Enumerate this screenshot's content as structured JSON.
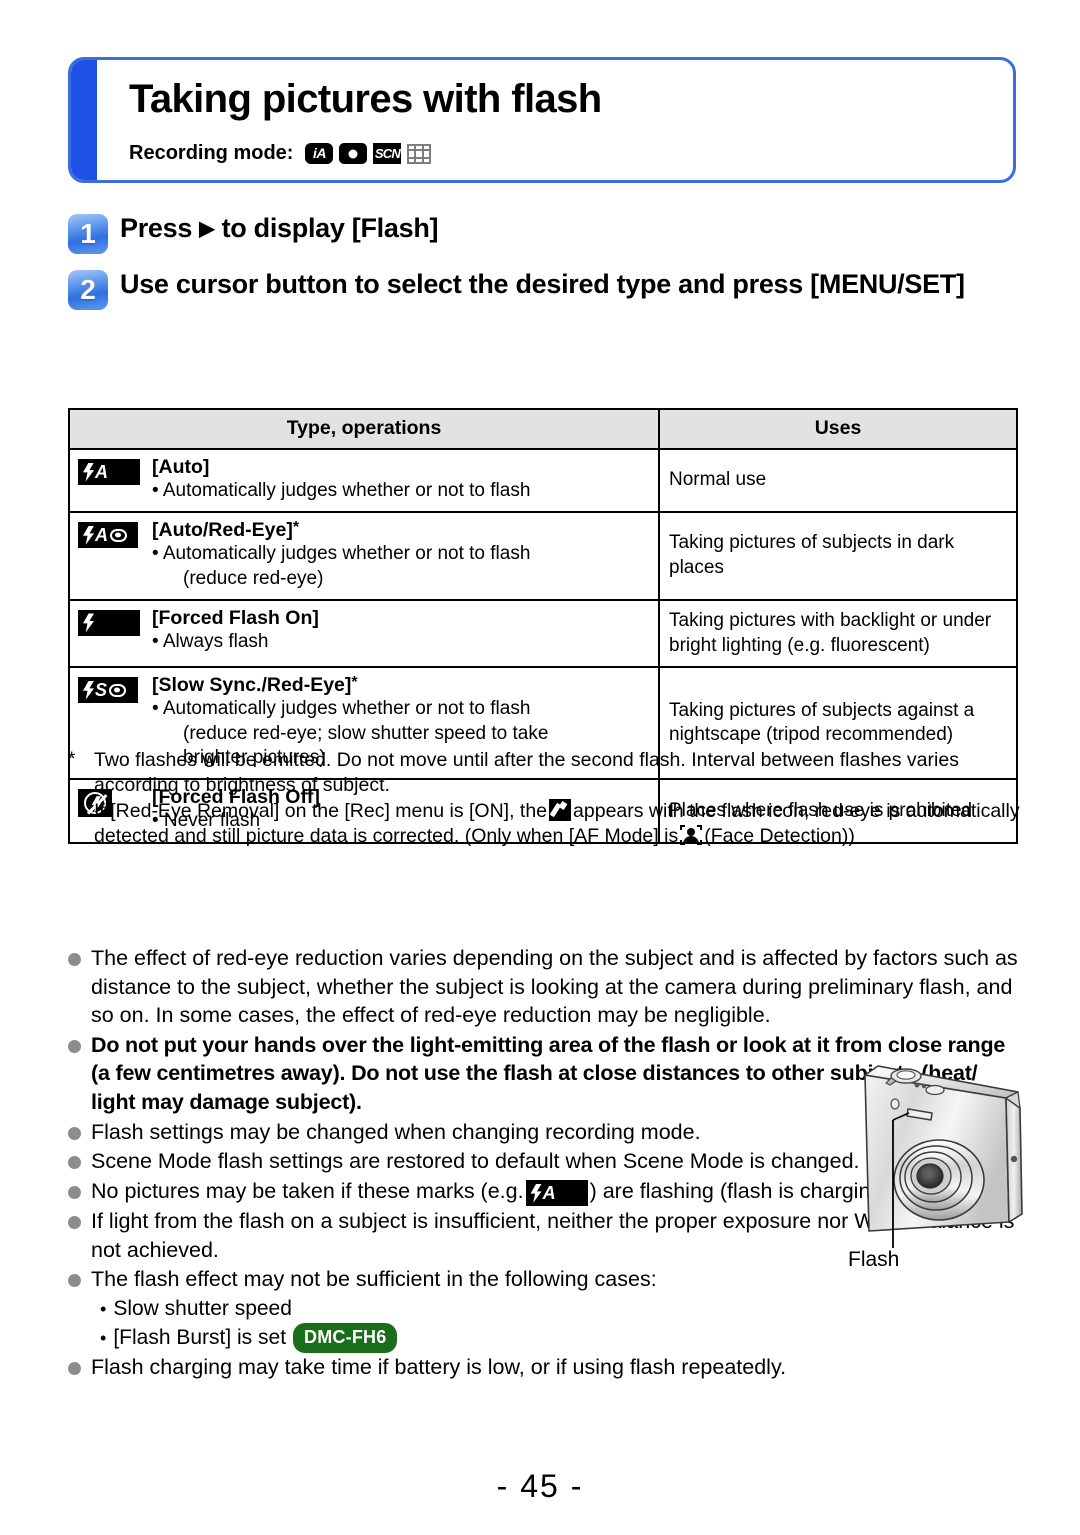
{
  "header": {
    "title": "Taking pictures with flash",
    "recording_mode_label": "Recording mode:",
    "mode_icons": [
      "iA",
      "camera",
      "SCN",
      "film"
    ]
  },
  "steps": [
    {
      "num": "1",
      "text_before": "Press ",
      "arrow": "▶",
      "text_after": " to display [Flash]"
    },
    {
      "num": "2",
      "text_before": "Use cursor button to select the desired type and press [MENU/SET]",
      "arrow": "",
      "text_after": ""
    }
  ],
  "table": {
    "headers": [
      "Type, operations",
      "Uses"
    ],
    "rows": [
      {
        "icon": "flash-auto",
        "name": "[Auto]",
        "star": "",
        "desc": "• Automatically judges whether or not to flash",
        "desc_cont": "",
        "desc_cont2": "",
        "uses": "Normal use"
      },
      {
        "icon": "flash-auto-redeye",
        "name": "[Auto/Red-Eye]",
        "star": "*",
        "desc": "• Automatically judges whether or not to flash",
        "desc_cont": "(reduce red-eye)",
        "desc_cont2": "",
        "uses": "Taking pictures of subjects in dark places"
      },
      {
        "icon": "flash-forced-on",
        "name": "[Forced Flash On]",
        "star": "",
        "desc": "• Always flash",
        "desc_cont": "",
        "desc_cont2": "",
        "uses": "Taking pictures with backlight or under bright lighting (e.g. fluorescent)"
      },
      {
        "icon": "flash-slow-sync-redeye",
        "name": "[Slow Sync./Red-Eye]",
        "star": "*",
        "desc": "• Automatically judges whether or not to flash",
        "desc_cont": "(reduce red-eye; slow shutter speed to take",
        "desc_cont2": "brighter pictures)",
        "uses": "Taking pictures of subjects against a nightscape (tripod recommended)"
      },
      {
        "icon": "flash-forced-off",
        "name": "[Forced Flash Off]",
        "star": "",
        "desc": "• Never flash",
        "desc_cont": "",
        "desc_cont2": "",
        "uses": "Places where flash use is prohibited"
      }
    ]
  },
  "footnote": {
    "marker": "*",
    "line1": "Two flashes will be emitted. Do not move until after the second flash. Interval between flashes varies according to brightness of subject.",
    "line2_a": "If [Red-Eye Removal] on the [Rec] menu is [ON], the",
    "line2_b": "appears with the flash icon, red-eye is automatically detected and still picture data is corrected. (Only when [AF Mode] is",
    "line2_c": "(Face Detection))"
  },
  "notes": [
    {
      "text": "The effect of red-eye reduction varies depending on the subject and is affected by factors such as distance to the subject, whether the subject is looking at the camera during preliminary flash, and so on. In some cases, the effect of red-eye reduction may be negligible.",
      "bold": false
    },
    {
      "text": "Do not put your hands over the light-emitting area of the flash or look at it from close range (a few centimetres away). Do not use the flash at close distances to other subjects (heat/ light may damage subject).",
      "bold": true
    },
    {
      "text": "Flash settings may be changed when changing recording mode.",
      "bold": false
    },
    {
      "text": "Scene Mode flash settings are restored to default when Scene Mode is changed.",
      "bold": false
    },
    {
      "text_a": "No pictures may be taken if these marks (e.g.",
      "text_b": ") are flashing (flash is charging).",
      "bold": false,
      "has_icon": true
    },
    {
      "text": "If light from the flash on a subject is insufficient, neither the proper exposure nor White Balance is not achieved.",
      "bold": false
    },
    {
      "text": "The flash effect may not be sufficient in the following cases:",
      "bold": false
    },
    {
      "text": "Flash charging may take time if battery is low, or if using flash repeatedly.",
      "bold": false
    }
  ],
  "sublist": [
    {
      "bullet": "•",
      "text": "Slow shutter speed",
      "badge": ""
    },
    {
      "bullet": "•",
      "text": "[Flash Burst] is set",
      "badge": "DMC-FH6"
    }
  ],
  "figure": {
    "caption": "Flash"
  },
  "footer": {
    "page_number": "- 45 -"
  },
  "colors": {
    "accent_blue": "#1d52e5",
    "border_blue": "#3a6ee0",
    "badge_green": "#1a6e1a",
    "table_header_grey": "#e2e2e2",
    "bullet_grey": "#8d8d8d"
  }
}
